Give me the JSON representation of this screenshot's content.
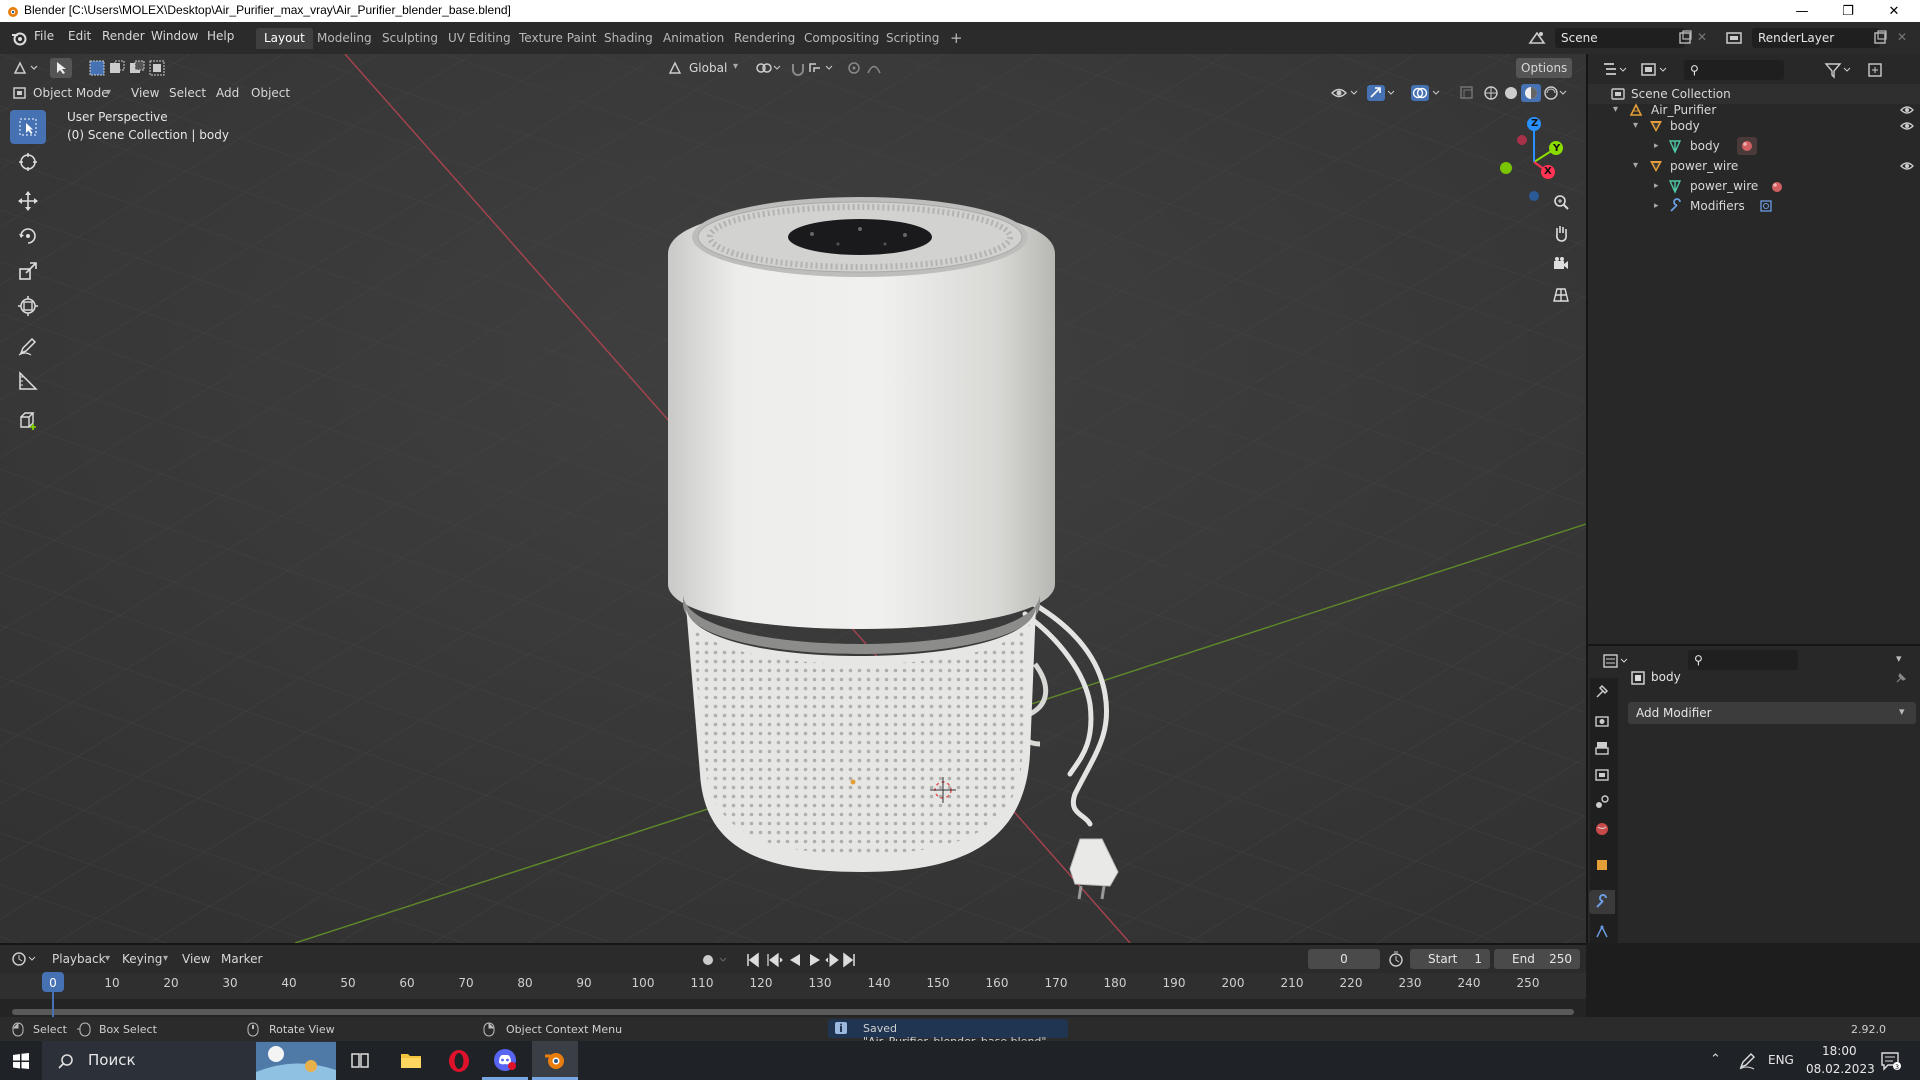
{
  "window": {
    "title": "Blender [C:\\Users\\MOLEX\\Desktop\\Air_Purifier_max_vray\\Air_Purifier_blender_base.blend]"
  },
  "menus": [
    "File",
    "Edit",
    "Render",
    "Window",
    "Help"
  ],
  "workspaces": [
    "Layout",
    "Modeling",
    "Sculpting",
    "UV Editing",
    "Texture Paint",
    "Shading",
    "Animation",
    "Rendering",
    "Compositing",
    "Scripting"
  ],
  "active_workspace": "Layout",
  "scene": {
    "name": "Scene",
    "view_layer": "RenderLayer"
  },
  "viewport": {
    "mode": "Object Mode",
    "menus": [
      "View",
      "Select",
      "Add",
      "Object"
    ],
    "transform_orientation": "Global",
    "options_label": "Options",
    "overlay_title": "User Perspective",
    "overlay_subtitle": "(0) Scene Collection | body",
    "gizmo_axes": {
      "x": "X",
      "y": "Y",
      "z": "Z"
    }
  },
  "outliner": {
    "root": "Scene Collection",
    "items": [
      {
        "label": "Air_Purifier",
        "depth": 1,
        "icon": "collection-icon"
      },
      {
        "label": "body",
        "depth": 2,
        "icon": "object-icon"
      },
      {
        "label": "body",
        "depth": 3,
        "icon": "mesh-icon"
      },
      {
        "label": "power_wire",
        "depth": 2,
        "icon": "object-icon"
      },
      {
        "label": "power_wire",
        "depth": 3,
        "icon": "mesh-icon"
      },
      {
        "label": "Modifiers",
        "depth": 3,
        "icon": "wrench-icon"
      }
    ]
  },
  "properties": {
    "object_name": "body",
    "add_modifier": "Add Modifier"
  },
  "timeline": {
    "menus": [
      "Playback",
      "Keying",
      "View",
      "Marker"
    ],
    "current_frame": "0",
    "start_label": "Start",
    "start": "1",
    "end_label": "End",
    "end": "250",
    "ruler": [
      "0",
      "10",
      "20",
      "30",
      "40",
      "50",
      "60",
      "70",
      "80",
      "90",
      "100",
      "110",
      "120",
      "130",
      "140",
      "150",
      "160",
      "170",
      "180",
      "190",
      "200",
      "210",
      "220",
      "230",
      "240",
      "250"
    ]
  },
  "statusbar": {
    "select": "Select",
    "box_select": "Box Select",
    "rotate_view": "Rotate View",
    "context_menu": "Object Context Menu",
    "message": "Saved \"Air_Purifier_blender_base.blend\"",
    "version": "2.92.0"
  },
  "taskbar": {
    "search": "Поиск",
    "lang": "ENG",
    "time": "18:00",
    "date": "08.02.2023"
  },
  "colors": {
    "accent": "#4672b4",
    "axis_x": "#ff3352",
    "axis_y": "#8bdc00",
    "axis_z": "#2890ff",
    "object_orange": "#e59f38"
  }
}
